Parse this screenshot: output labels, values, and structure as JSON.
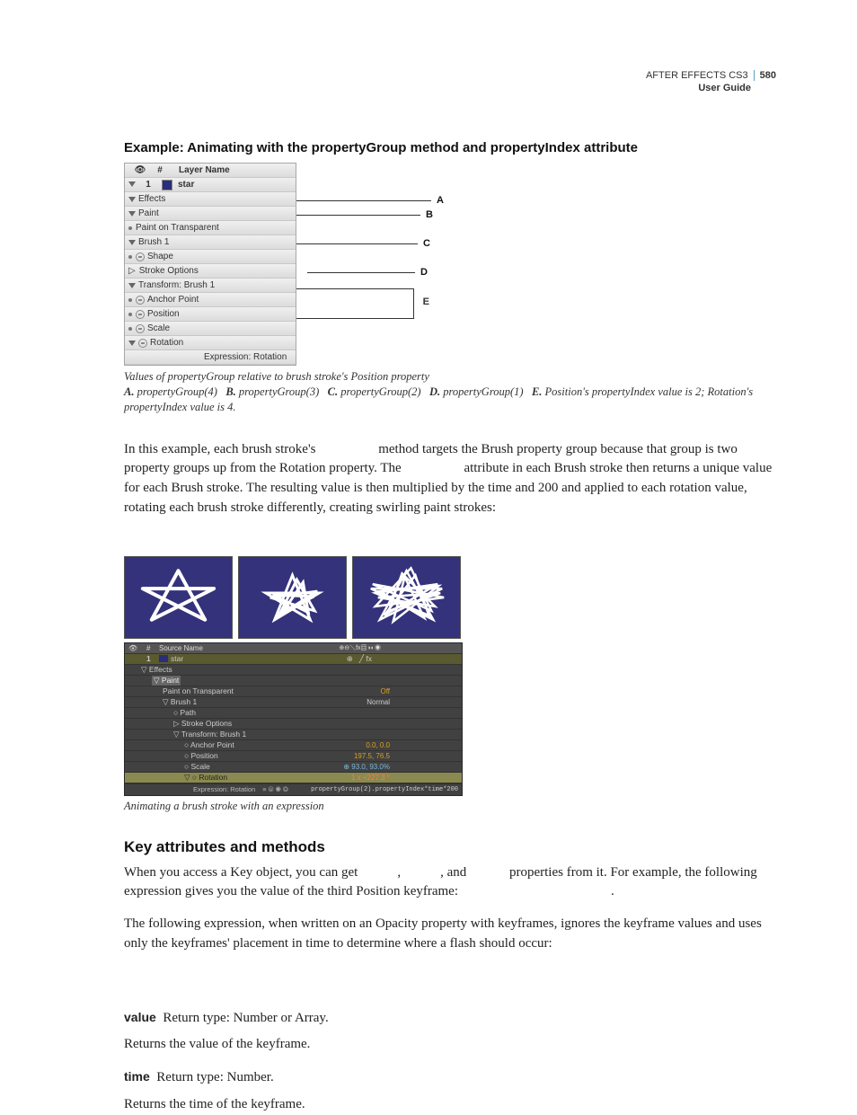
{
  "header": {
    "product": "AFTER EFFECTS CS3",
    "page": "580",
    "guide": "User Guide"
  },
  "section_title": "Example: Animating with the propertyGroup method and propertyIndex attribute",
  "fig1": {
    "headers": {
      "num": "#",
      "layer": "Layer Name"
    },
    "layer": {
      "num": "1",
      "name": "star"
    },
    "rows": {
      "effects": "Effects",
      "paint": "Paint",
      "pot": "Paint on Transparent",
      "brush": "Brush 1",
      "shape": "Shape",
      "strokeopts": "Stroke Options",
      "transform": "Transform: Brush 1",
      "anchor": "Anchor Point",
      "position": "Position",
      "scale": "Scale",
      "rotation": "Rotation",
      "expr": "Expression: Rotation"
    },
    "annotations": {
      "A": "A",
      "B": "B",
      "C": "C",
      "D": "D",
      "E": "E"
    }
  },
  "caption1": {
    "intro": "Values of propertyGroup relative to brush stroke's Position property",
    "A": "propertyGroup(4)",
    "B": "propertyGroup(3)",
    "C": "propertyGroup(2)",
    "D": "propertyGroup(1)",
    "E": "Position's propertyIndex value is 2; Rotation's propertyIndex value is 4."
  },
  "para1_a": "In this example, each brush stroke's",
  "para1_b": "method targets the Brush property group because that group is two property groups up from the Rotation property. The",
  "para1_c": "attribute in each Brush stroke then returns a unique value for each Brush stroke. The resulting value is then multiplied by the time and 200 and applied to each rotation value, rotating each brush stroke differently, creating swirling paint strokes:",
  "fig2": {
    "thead": {
      "source": "Source Name"
    },
    "layer": {
      "num": "1",
      "name": "star"
    },
    "rows": {
      "effects": "Effects",
      "paint": "Paint",
      "pot": "Paint on Transparent",
      "pot_val": "Off",
      "brush": "Brush 1",
      "brush_val": "Normal",
      "path": "Path",
      "strokeopts": "Stroke Options",
      "transform": "Transform: Brush 1",
      "anchor": "Anchor Point",
      "anchor_val": "0.0, 0.0",
      "position": "Position",
      "position_val": "197.5, 76.5",
      "scale": "Scale",
      "scale_val": "93.0, 93.0%",
      "rotation": "Rotation",
      "rotation_val": "1 x +227.3 °",
      "expr": "Expression: Rotation",
      "expr_code": "propertyGroup(2).propertyIndex*time*200"
    }
  },
  "caption2": "Animating a brush stroke with an expression",
  "subhead": "Key attributes and methods",
  "para2_a": "When you access a Key object, you can get",
  "para2_b": ",",
  "para2_c": ", and",
  "para2_d": "properties from it. For example, the following expression gives you the value of the third Position keyframe:",
  "para3": "The following expression, when written on an Opacity property with keyframes, ignores the keyframe values and uses only the keyframes' placement in time to determine where a flash should occur:",
  "def_value_label": "value",
  "def_value_ret": "Return type: Number or Array.",
  "def_value_desc": "Returns the value of the keyframe.",
  "def_time_label": "time",
  "def_time_ret": "Return type: Number.",
  "def_time_desc": "Returns the time of the keyframe."
}
